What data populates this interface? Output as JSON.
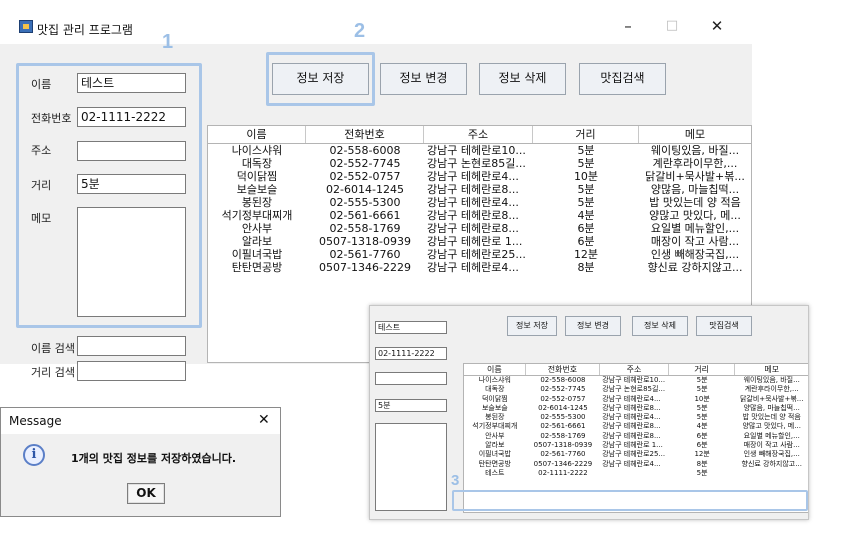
{
  "window": {
    "title": "맛집 관리 프로그램",
    "minimize": "–",
    "maximize": "□",
    "close": "✕"
  },
  "annotations": {
    "one": "1",
    "two": "2",
    "three": "3"
  },
  "form": {
    "name_label": "이름",
    "name_value": "테스트",
    "phone_label": "전화번호",
    "phone_value": "02-1111-2222",
    "address_label": "주소",
    "address_value": "",
    "distance_label": "거리",
    "distance_value": "5분",
    "memo_label": "메모",
    "search_name_label": "이름 검색",
    "search_distance_label": "거리 검색"
  },
  "toolbar": {
    "save": "정보 저장",
    "edit": "정보 변경",
    "delete": "정보 삭제",
    "search": "맛집검색"
  },
  "table": {
    "columns": [
      "이름",
      "전화번호",
      "주소",
      "거리",
      "메모"
    ],
    "rows": [
      [
        "나이스샤워",
        "02-558-6008",
        "강남구 테헤란로10...",
        "5분",
        "웨이팅있음, 바질..."
      ],
      [
        "대독장",
        "02-552-7745",
        "강남구 논현로85길...",
        "5분",
        "계란후라이무한,..."
      ],
      [
        "덕이닭찜",
        "02-552-0757",
        "강남구 테헤란로4...",
        "10분",
        "닭갈비+묵사발+볶..."
      ],
      [
        "보슬보슬",
        "02-6014-1245",
        "강남구 테헤란로8...",
        "5분",
        "양많음, 마늘칩떡..."
      ],
      [
        "봉된장",
        "02-555-5300",
        "강남구 테헤란로4...",
        "5분",
        "밥 맛있는데 양 적음"
      ],
      [
        "석기정부대찌개",
        "02-561-6661",
        "강남구 테헤란로8...",
        "4분",
        "양많고 맛있다, 메..."
      ],
      [
        "안사부",
        "02-558-1769",
        "강남구 테헤란로8...",
        "6분",
        "요일별 메뉴할인,..."
      ],
      [
        "알라보",
        "0507-1318-0939",
        "강남구 테헤란로 1...",
        "6분",
        "매장이 작고 사람..."
      ],
      [
        "이필녀국밥",
        "02-561-7760",
        "강남구 테헤란로25...",
        "12분",
        "인생 빼해장국집,..."
      ],
      [
        "탄탄면공방",
        "0507-1346-2229",
        "강남구 테헤란로4...",
        "8분",
        "향신료 강하지않고..."
      ]
    ],
    "new_row": [
      "테스트",
      "02-1111-2222",
      "",
      "5분",
      ""
    ]
  },
  "dialog": {
    "title": "Message",
    "close": "✕",
    "icon": "i",
    "message": "1개의 맛집 정보를 저장하였습니다.",
    "ok": "OK"
  },
  "overlay": {
    "name_value": "테스트",
    "phone_value": "02-1111-2222",
    "address_value": "",
    "distance_value": "5분"
  },
  "colors": {
    "annotation": "#9cbfe6",
    "window_bg": "#f0f0f0",
    "info_icon": "#2f57a8"
  }
}
